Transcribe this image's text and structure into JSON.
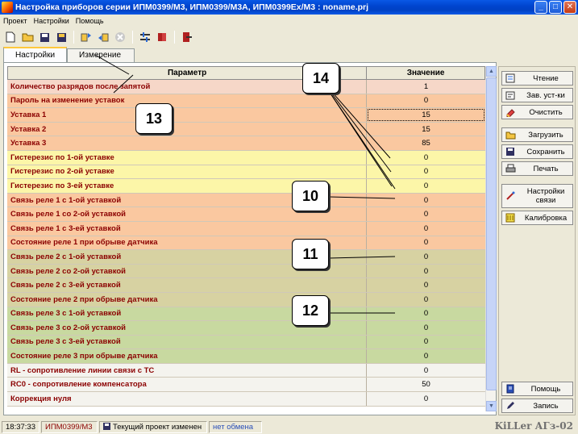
{
  "window": {
    "title": "Настройка приборов серии ИПМ0399/М3, ИПМ0399/М3А, ИПМ0399Ex/М3 : noname.prj",
    "minimize_icon": "minimize-icon",
    "maximize_icon": "maximize-icon",
    "close_icon": "close-icon"
  },
  "menu": {
    "items": [
      "Проект",
      "Настройки",
      "Помощь"
    ]
  },
  "toolbar": {
    "icons": [
      "new-file-icon",
      "open-folder-icon",
      "save-icon",
      "save-as-icon",
      "read-device-icon",
      "write-device-icon",
      "stop-icon",
      "settings-icon",
      "book-icon",
      "exit-icon"
    ]
  },
  "tabs": [
    {
      "label": "Настройки",
      "active": true
    },
    {
      "label": "Измерение",
      "active": false
    }
  ],
  "grid": {
    "header_param": "Параметр",
    "header_value": "Значение",
    "rows": [
      {
        "label": "Количество разрядов после запятой",
        "value": "1",
        "bg": "#F6D7C8"
      },
      {
        "label": "Пароль на изменение уставок",
        "value": "0",
        "bg": "#FAC8A0"
      },
      {
        "label": "Уставка 1",
        "value": "15",
        "bg": "#FAC8A0"
      },
      {
        "label": "Уставка 2",
        "value": "15",
        "bg": "#FAC8A0"
      },
      {
        "label": "Уставка 3",
        "value": "85",
        "bg": "#FAC8A0"
      },
      {
        "label": "Гистерезис по 1-ой уставке",
        "value": "0",
        "bg": "#FCF6A8"
      },
      {
        "label": "Гистерезис по 2-ой уставке",
        "value": "0",
        "bg": "#FCF6A8"
      },
      {
        "label": "Гистерезис по 3-ей уставке",
        "value": "0",
        "bg": "#FCF6A8"
      },
      {
        "label": "Связь реле 1 с 1-ой уставкой",
        "value": "0",
        "bg": "#FAC8A0"
      },
      {
        "label": "Связь реле 1 со 2-ой уставкой",
        "value": "0",
        "bg": "#FAC8A0"
      },
      {
        "label": "Связь реле 1 с 3-ей уставкой",
        "value": "0",
        "bg": "#FAC8A0"
      },
      {
        "label": "Состояние реле 1 при обрыве датчика",
        "value": "0",
        "bg": "#FAC8A0"
      },
      {
        "label": "Связь реле 2 с 1-ой уставкой",
        "value": "0",
        "bg": "#D7D2A2"
      },
      {
        "label": "Связь реле 2 со 2-ой уставкой",
        "value": "0",
        "bg": "#D7D2A2"
      },
      {
        "label": "Связь реле 2 с 3-ей уставкой",
        "value": "0",
        "bg": "#D7D2A2"
      },
      {
        "label": "Состояние реле 2 при обрыве датчика",
        "value": "0",
        "bg": "#D7D2A2"
      },
      {
        "label": "Связь реле 3 с 1-ой уставкой",
        "value": "0",
        "bg": "#C8D9A0"
      },
      {
        "label": "Связь реле 3 со 2-ой уставкой",
        "value": "0",
        "bg": "#C8D9A0"
      },
      {
        "label": "Связь реле 3 с 3-ей уставкой",
        "value": "0",
        "bg": "#C8D9A0"
      },
      {
        "label": "Состояние реле 3 при обрыве датчика",
        "value": "0",
        "bg": "#C8D9A0"
      },
      {
        "label": "RL - сопротивление линии связи с ТС",
        "value": "0",
        "bg": "#F4F3EE"
      },
      {
        "label": "RC0 - сопротивление компенсатора",
        "value": "50",
        "bg": "#F4F3EE"
      },
      {
        "label": "Коррекция нуля",
        "value": "0",
        "bg": "#F4F3EE"
      }
    ]
  },
  "side_buttons": {
    "read": {
      "label": "Чтение",
      "icon": "read-icon"
    },
    "factory": {
      "label": "Зав. уст-ки",
      "icon": "factory-settings-icon"
    },
    "clear": {
      "label": "Очистить",
      "icon": "eraser-icon"
    },
    "load": {
      "label": "Загрузить",
      "icon": "folder-icon"
    },
    "save": {
      "label": "Сохранить",
      "icon": "floppy-icon"
    },
    "print": {
      "label": "Печать",
      "icon": "printer-icon"
    },
    "comm_line1": "Настройки",
    "comm_line2": "связи",
    "comm_icon": "connection-icon",
    "calib": {
      "label": "Калибровка",
      "icon": "calibration-icon"
    },
    "help": {
      "label": "Помощь",
      "icon": "help-book-icon"
    },
    "write": {
      "label": "Запись",
      "icon": "pen-icon"
    }
  },
  "status": {
    "time": "18:37:33",
    "model": "ИПМ0399/М3",
    "project_state": "Текущий проект изменен",
    "exchange": "нет обмена",
    "watermark": "KiLLer АГз-02"
  },
  "callouts": [
    "14",
    "13",
    "10",
    "11",
    "12"
  ],
  "colors": {
    "title_bar": "#0A58E6",
    "param_text": "#8B0000",
    "window_bg": "#ECE9D8"
  }
}
